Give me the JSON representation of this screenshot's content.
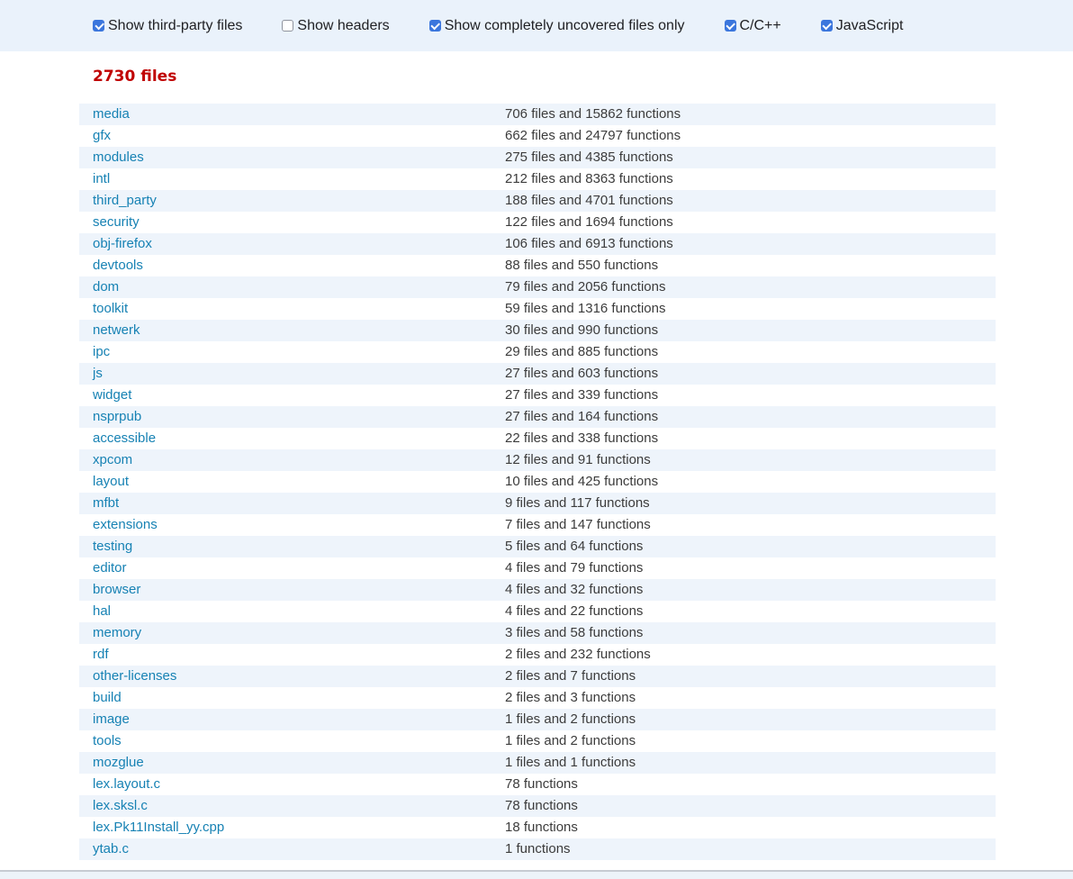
{
  "colors": {
    "header_bg": "#eaf2fb",
    "stripe_bg": "#eef4fb",
    "link": "#1782b4",
    "heading_red": "#c00000",
    "checkbox_blue": "#3b76dd",
    "stats_text": "#3c3c3c",
    "footer_border": "#c6cbd2"
  },
  "filter_bar": {
    "checkboxes": [
      {
        "label": "Show third-party files",
        "checked": true
      },
      {
        "label": "Show headers",
        "checked": false
      },
      {
        "label": "Show completely uncovered files only",
        "checked": true
      },
      {
        "label": "C/C++",
        "checked": true
      },
      {
        "label": "JavaScript",
        "checked": true
      }
    ]
  },
  "summary": {
    "heading": "2730 files"
  },
  "table": {
    "rows": [
      {
        "name": "media",
        "stats": "706 files and 15862 functions"
      },
      {
        "name": "gfx",
        "stats": "662 files and 24797 functions"
      },
      {
        "name": "modules",
        "stats": "275 files and 4385 functions"
      },
      {
        "name": "intl",
        "stats": "212 files and 8363 functions"
      },
      {
        "name": "third_party",
        "stats": "188 files and 4701 functions"
      },
      {
        "name": "security",
        "stats": "122 files and 1694 functions"
      },
      {
        "name": "obj-firefox",
        "stats": "106 files and 6913 functions"
      },
      {
        "name": "devtools",
        "stats": "88 files and 550 functions"
      },
      {
        "name": "dom",
        "stats": "79 files and 2056 functions"
      },
      {
        "name": "toolkit",
        "stats": "59 files and 1316 functions"
      },
      {
        "name": "netwerk",
        "stats": "30 files and 990 functions"
      },
      {
        "name": "ipc",
        "stats": "29 files and 885 functions"
      },
      {
        "name": "js",
        "stats": "27 files and 603 functions"
      },
      {
        "name": "widget",
        "stats": "27 files and 339 functions"
      },
      {
        "name": "nsprpub",
        "stats": "27 files and 164 functions"
      },
      {
        "name": "accessible",
        "stats": "22 files and 338 functions"
      },
      {
        "name": "xpcom",
        "stats": "12 files and 91 functions"
      },
      {
        "name": "layout",
        "stats": "10 files and 425 functions"
      },
      {
        "name": "mfbt",
        "stats": "9 files and 117 functions"
      },
      {
        "name": "extensions",
        "stats": "7 files and 147 functions"
      },
      {
        "name": "testing",
        "stats": "5 files and 64 functions"
      },
      {
        "name": "editor",
        "stats": "4 files and 79 functions"
      },
      {
        "name": "browser",
        "stats": "4 files and 32 functions"
      },
      {
        "name": "hal",
        "stats": "4 files and 22 functions"
      },
      {
        "name": "memory",
        "stats": "3 files and 58 functions"
      },
      {
        "name": "rdf",
        "stats": "2 files and 232 functions"
      },
      {
        "name": "other-licenses",
        "stats": "2 files and 7 functions"
      },
      {
        "name": "build",
        "stats": "2 files and 3 functions"
      },
      {
        "name": "image",
        "stats": "1 files and 2 functions"
      },
      {
        "name": "tools",
        "stats": "1 files and 2 functions"
      },
      {
        "name": "mozglue",
        "stats": "1 files and 1 functions"
      },
      {
        "name": "lex.layout.c",
        "stats": "78 functions"
      },
      {
        "name": "lex.sksl.c",
        "stats": "78 functions"
      },
      {
        "name": "lex.Pk11Install_yy.cpp",
        "stats": "18 functions"
      },
      {
        "name": "ytab.c",
        "stats": "1 functions"
      }
    ]
  }
}
